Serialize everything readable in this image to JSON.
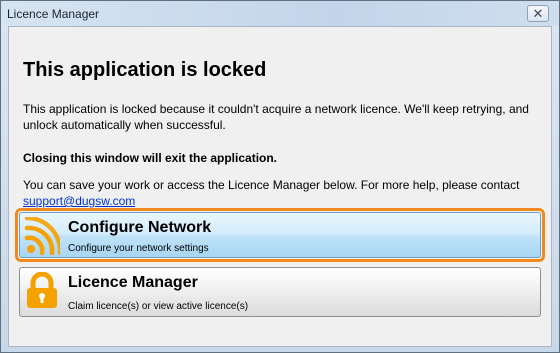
{
  "window": {
    "title": "Licence Manager",
    "close_glyph": "✕"
  },
  "content": {
    "heading": "This application is locked",
    "paragraph1": "This application is locked because it couldn't acquire a network licence. We'll keep retrying, and unlock automatically when successful.",
    "paragraph2": "Closing this window will exit the application.",
    "paragraph3": "You can save your work or access the Licence Manager below. For more help, please contact",
    "support_email": "support@dugsw.com"
  },
  "commands": [
    {
      "title": "Configure Network",
      "subtitle": "Configure your network settings",
      "icon": "wifi-signal-icon",
      "color": "#f5a100"
    },
    {
      "title": "Licence Manager",
      "subtitle": "Claim licence(s) or view active licence(s)",
      "icon": "padlock-icon",
      "color": "#f5a100"
    }
  ],
  "colors": {
    "focus_ring": "#f08a1e",
    "hover_button": "#bfe3f8",
    "link": "#0033cc"
  }
}
